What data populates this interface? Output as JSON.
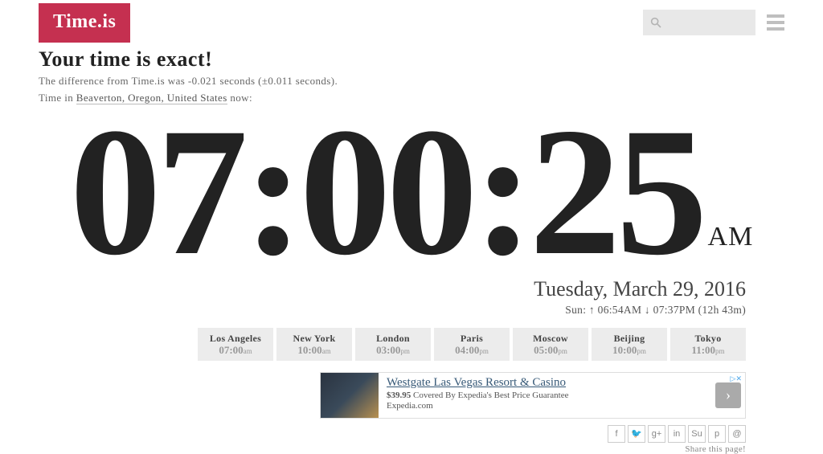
{
  "logo": "Time.is",
  "headline": "Your time is exact!",
  "diff_line": "The difference from Time.is was -0.021 seconds (±0.011 seconds).",
  "loc_prefix": "Time in ",
  "loc_link": "Beaverton, Oregon, United States",
  "loc_suffix": " now:",
  "clock": {
    "time": "07:00:25",
    "ampm": "AM"
  },
  "date": "Tuesday, March 29, 2016",
  "sun": "Sun: ↑ 06:54AM ↓ 07:37PM (12h 43m)",
  "cities": [
    {
      "name": "Los Angeles",
      "time": "07:00",
      "suffix": "am"
    },
    {
      "name": "New York",
      "time": "10:00",
      "suffix": "am"
    },
    {
      "name": "London",
      "time": "03:00",
      "suffix": "pm"
    },
    {
      "name": "Paris",
      "time": "04:00",
      "suffix": "pm"
    },
    {
      "name": "Moscow",
      "time": "05:00",
      "suffix": "pm"
    },
    {
      "name": "Beijing",
      "time": "10:00",
      "suffix": "pm"
    },
    {
      "name": "Tokyo",
      "time": "11:00",
      "suffix": "pm"
    }
  ],
  "ad": {
    "title": "Westgate Las Vegas Resort & Casino",
    "price": "$39.95",
    "sub": " Covered By Expedia's Best Price Guarantee",
    "source": "Expedia.com",
    "tag": "▷✕"
  },
  "share": {
    "icons": [
      "f",
      "🐦",
      "g+",
      "in",
      "Su",
      "p",
      "@"
    ],
    "label": "Share this page!"
  }
}
